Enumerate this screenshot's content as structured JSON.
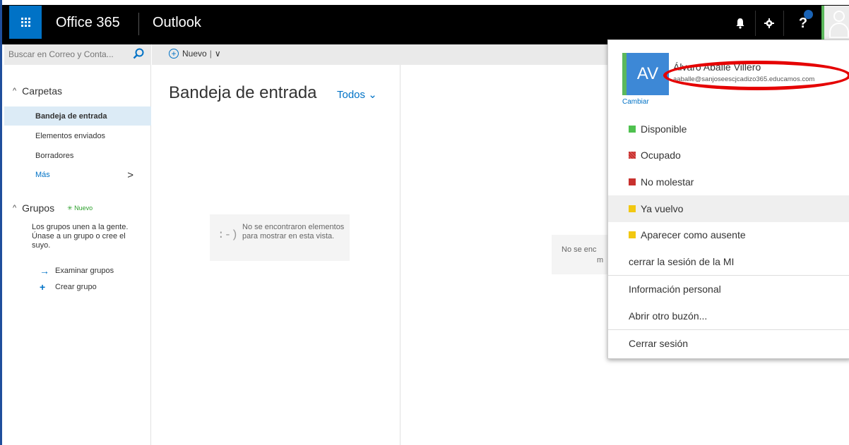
{
  "app": {
    "brand": "Office 365",
    "name": "Outlook"
  },
  "topbar_icons": [
    "waffle-icon",
    "bell-icon",
    "gear-icon",
    "help-icon",
    "user-avatar"
  ],
  "search": {
    "placeholder": "Buscar en Correo y Conta..."
  },
  "command_bar": {
    "new_label": "Nuevo",
    "separator": "|",
    "dropdown_chevron": "∨"
  },
  "sidebar": {
    "folders_header": "Carpetas",
    "folders": [
      {
        "label": "Bandeja de entrada",
        "selected": true
      },
      {
        "label": "Elementos enviados",
        "selected": false
      },
      {
        "label": "Borradores",
        "selected": false
      }
    ],
    "more_label": "Más",
    "groups_header": "Grupos",
    "groups_new_badge": "✳ Nuevo",
    "groups_description": "Los grupos unen a la gente. Únase a un grupo o cree el suyo.",
    "browse_groups": "Examinar grupos",
    "create_group": "Crear grupo"
  },
  "message_list": {
    "folder_title": "Bandeja de entrada",
    "filter": "Todos",
    "empty_face": ":-)",
    "empty_text": "No se encontraron elementos para mostrar en esta vista."
  },
  "reading_pane": {
    "line1": "No se enc",
    "line2": "m"
  },
  "user_menu": {
    "initials": "AV",
    "name": "Álvaro Aballe Villero",
    "email": "aaballe@sanjoseescjcadizo365.educamos.com",
    "change_link": "Cambiar",
    "statuses": [
      {
        "label": "Disponible",
        "color": "#4fc14f"
      },
      {
        "label": "Ocupado",
        "color": "#c8312e"
      },
      {
        "label": "No molestar",
        "color": "#c8312e"
      },
      {
        "label": "Ya vuelvo",
        "color": "#f2c811"
      },
      {
        "label": "Aparecer como ausente",
        "color": "#f2c811"
      }
    ],
    "signout_im": "cerrar la sesión de la MI",
    "personal_info": "Información personal",
    "open_mailbox": "Abrir otro buzón...",
    "signout": "Cerrar sesión"
  },
  "colors": {
    "accent": "#0072c6",
    "topbar": "#000000",
    "annotation": "#e50000"
  }
}
